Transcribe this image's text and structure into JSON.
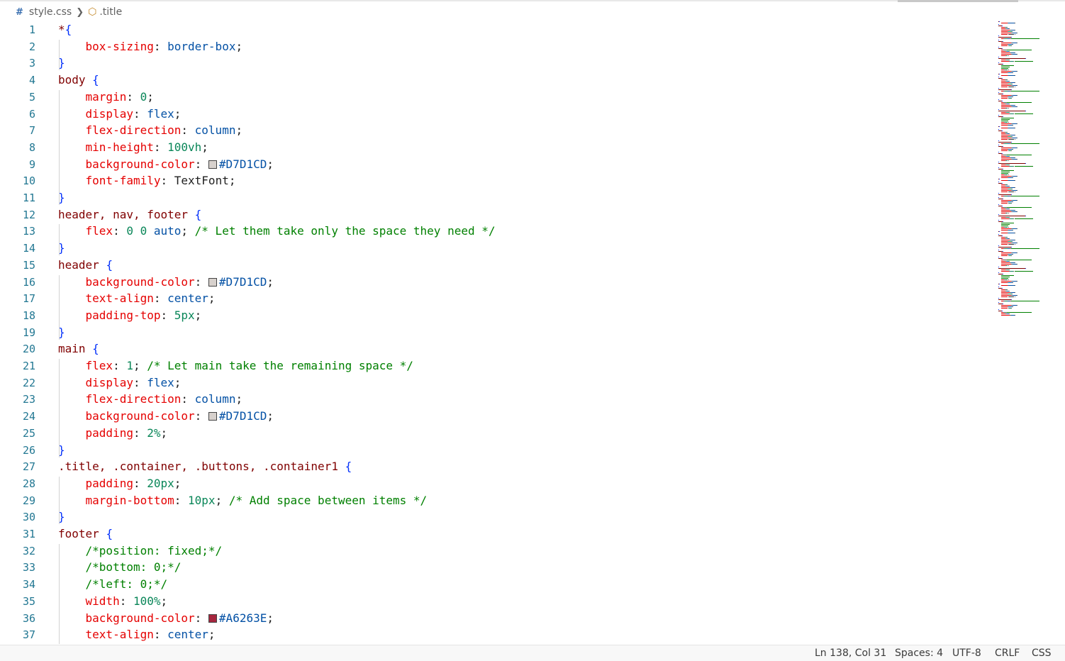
{
  "breadcrumb": {
    "file": "style.css",
    "symbol": ".title"
  },
  "editor": {
    "lines": [
      {
        "n": "1",
        "t": [
          [
            "*",
            "sel"
          ],
          [
            "{",
            "brace"
          ]
        ]
      },
      {
        "n": "2",
        "t": [
          [
            "    ",
            ""
          ],
          [
            "box-sizing",
            "prop"
          ],
          [
            ": ",
            "punc"
          ],
          [
            "border-box",
            "val"
          ],
          [
            ";",
            "punc"
          ]
        ]
      },
      {
        "n": "3",
        "t": [
          [
            "}",
            "brace"
          ]
        ]
      },
      {
        "n": "4",
        "t": [
          [
            "body ",
            "sel"
          ],
          [
            "{",
            "brace"
          ]
        ]
      },
      {
        "n": "5",
        "t": [
          [
            "    ",
            ""
          ],
          [
            "margin",
            "prop"
          ],
          [
            ": ",
            "punc"
          ],
          [
            "0",
            "num"
          ],
          [
            ";",
            "punc"
          ]
        ]
      },
      {
        "n": "6",
        "t": [
          [
            "    ",
            ""
          ],
          [
            "display",
            "prop"
          ],
          [
            ": ",
            "punc"
          ],
          [
            "flex",
            "val"
          ],
          [
            ";",
            "punc"
          ]
        ]
      },
      {
        "n": "7",
        "t": [
          [
            "    ",
            ""
          ],
          [
            "flex-direction",
            "prop"
          ],
          [
            ": ",
            "punc"
          ],
          [
            "column",
            "val"
          ],
          [
            ";",
            "punc"
          ]
        ]
      },
      {
        "n": "8",
        "t": [
          [
            "    ",
            ""
          ],
          [
            "min-height",
            "prop"
          ],
          [
            ": ",
            "punc"
          ],
          [
            "100vh",
            "num"
          ],
          [
            ";",
            "punc"
          ]
        ]
      },
      {
        "n": "9",
        "t": [
          [
            "    ",
            ""
          ],
          [
            "background-color",
            "prop"
          ],
          [
            ": ",
            "punc"
          ],
          [
            "#D7D1CD",
            "color"
          ],
          [
            ";",
            "punc"
          ]
        ]
      },
      {
        "n": "10",
        "t": [
          [
            "    ",
            ""
          ],
          [
            "font-family",
            "prop"
          ],
          [
            ": ",
            "punc"
          ],
          [
            "TextFont",
            "plain"
          ],
          [
            ";",
            "punc"
          ]
        ]
      },
      {
        "n": "11",
        "t": [
          [
            "}",
            "brace"
          ]
        ]
      },
      {
        "n": "12",
        "t": [
          [
            "header, nav, footer ",
            "sel"
          ],
          [
            "{",
            "brace"
          ]
        ]
      },
      {
        "n": "13",
        "t": [
          [
            "    ",
            ""
          ],
          [
            "flex",
            "prop"
          ],
          [
            ": ",
            "punc"
          ],
          [
            "0 0 ",
            "num"
          ],
          [
            "auto",
            "val"
          ],
          [
            "; ",
            "punc"
          ],
          [
            "/* Let them take only the space they need */",
            "com"
          ]
        ]
      },
      {
        "n": "14",
        "t": [
          [
            "}",
            "brace"
          ]
        ]
      },
      {
        "n": "15",
        "t": [
          [
            "header ",
            "sel"
          ],
          [
            "{",
            "brace"
          ]
        ]
      },
      {
        "n": "16",
        "t": [
          [
            "    ",
            ""
          ],
          [
            "background-color",
            "prop"
          ],
          [
            ": ",
            "punc"
          ],
          [
            "#D7D1CD",
            "color"
          ],
          [
            ";",
            "punc"
          ]
        ]
      },
      {
        "n": "17",
        "t": [
          [
            "    ",
            ""
          ],
          [
            "text-align",
            "prop"
          ],
          [
            ": ",
            "punc"
          ],
          [
            "center",
            "val"
          ],
          [
            ";",
            "punc"
          ]
        ]
      },
      {
        "n": "18",
        "t": [
          [
            "    ",
            ""
          ],
          [
            "padding-top",
            "prop"
          ],
          [
            ": ",
            "punc"
          ],
          [
            "5px",
            "num"
          ],
          [
            ";",
            "punc"
          ]
        ]
      },
      {
        "n": "19",
        "t": [
          [
            "}",
            "brace"
          ]
        ]
      },
      {
        "n": "20",
        "t": [
          [
            "main ",
            "sel"
          ],
          [
            "{",
            "brace"
          ]
        ]
      },
      {
        "n": "21",
        "t": [
          [
            "    ",
            ""
          ],
          [
            "flex",
            "prop"
          ],
          [
            ": ",
            "punc"
          ],
          [
            "1",
            "num"
          ],
          [
            "; ",
            "punc"
          ],
          [
            "/* Let main take the remaining space */",
            "com"
          ]
        ]
      },
      {
        "n": "22",
        "t": [
          [
            "    ",
            ""
          ],
          [
            "display",
            "prop"
          ],
          [
            ": ",
            "punc"
          ],
          [
            "flex",
            "val"
          ],
          [
            ";",
            "punc"
          ]
        ]
      },
      {
        "n": "23",
        "t": [
          [
            "    ",
            ""
          ],
          [
            "flex-direction",
            "prop"
          ],
          [
            ": ",
            "punc"
          ],
          [
            "column",
            "val"
          ],
          [
            ";",
            "punc"
          ]
        ]
      },
      {
        "n": "24",
        "t": [
          [
            "    ",
            ""
          ],
          [
            "background-color",
            "prop"
          ],
          [
            ": ",
            "punc"
          ],
          [
            "#D7D1CD",
            "color"
          ],
          [
            ";",
            "punc"
          ]
        ]
      },
      {
        "n": "25",
        "t": [
          [
            "    ",
            ""
          ],
          [
            "padding",
            "prop"
          ],
          [
            ": ",
            "punc"
          ],
          [
            "2%",
            "num"
          ],
          [
            ";",
            "punc"
          ]
        ]
      },
      {
        "n": "26",
        "t": [
          [
            "}",
            "brace"
          ]
        ]
      },
      {
        "n": "27",
        "t": [
          [
            ".title, .container, .buttons, .container1 ",
            "sel"
          ],
          [
            "{",
            "brace"
          ]
        ]
      },
      {
        "n": "28",
        "t": [
          [
            "    ",
            ""
          ],
          [
            "padding",
            "prop"
          ],
          [
            ": ",
            "punc"
          ],
          [
            "20px",
            "num"
          ],
          [
            ";",
            "punc"
          ]
        ]
      },
      {
        "n": "29",
        "t": [
          [
            "    ",
            ""
          ],
          [
            "margin-bottom",
            "prop"
          ],
          [
            ": ",
            "punc"
          ],
          [
            "10px",
            "num"
          ],
          [
            "; ",
            "punc"
          ],
          [
            "/* Add space between items */",
            "com"
          ]
        ]
      },
      {
        "n": "30",
        "t": [
          [
            "}",
            "brace"
          ]
        ]
      },
      {
        "n": "31",
        "t": [
          [
            "footer ",
            "sel"
          ],
          [
            "{",
            "brace"
          ]
        ]
      },
      {
        "n": "32",
        "t": [
          [
            "    ",
            ""
          ],
          [
            "/*position: fixed;*/",
            "com"
          ]
        ]
      },
      {
        "n": "33",
        "t": [
          [
            "    ",
            ""
          ],
          [
            "/*bottom: 0;*/",
            "com"
          ]
        ]
      },
      {
        "n": "34",
        "t": [
          [
            "    ",
            ""
          ],
          [
            "/*left: 0;*/",
            "com"
          ]
        ]
      },
      {
        "n": "35",
        "t": [
          [
            "    ",
            ""
          ],
          [
            "width",
            "prop"
          ],
          [
            ": ",
            "punc"
          ],
          [
            "100%",
            "num"
          ],
          [
            ";",
            "punc"
          ]
        ]
      },
      {
        "n": "36",
        "t": [
          [
            "    ",
            ""
          ],
          [
            "background-color",
            "prop"
          ],
          [
            ": ",
            "punc"
          ],
          [
            "#A6263E",
            "color"
          ],
          [
            ";",
            "punc"
          ]
        ]
      },
      {
        "n": "37",
        "t": [
          [
            "    ",
            ""
          ],
          [
            "text-align",
            "prop"
          ],
          [
            ": ",
            "punc"
          ],
          [
            "center",
            "val"
          ],
          [
            ";",
            "punc"
          ]
        ]
      }
    ]
  },
  "statusbar": {
    "position": "Ln 138, Col 31",
    "spaces": "Spaces: 4",
    "encoding": "UTF-8",
    "eol": "CRLF",
    "language": "CSS"
  }
}
